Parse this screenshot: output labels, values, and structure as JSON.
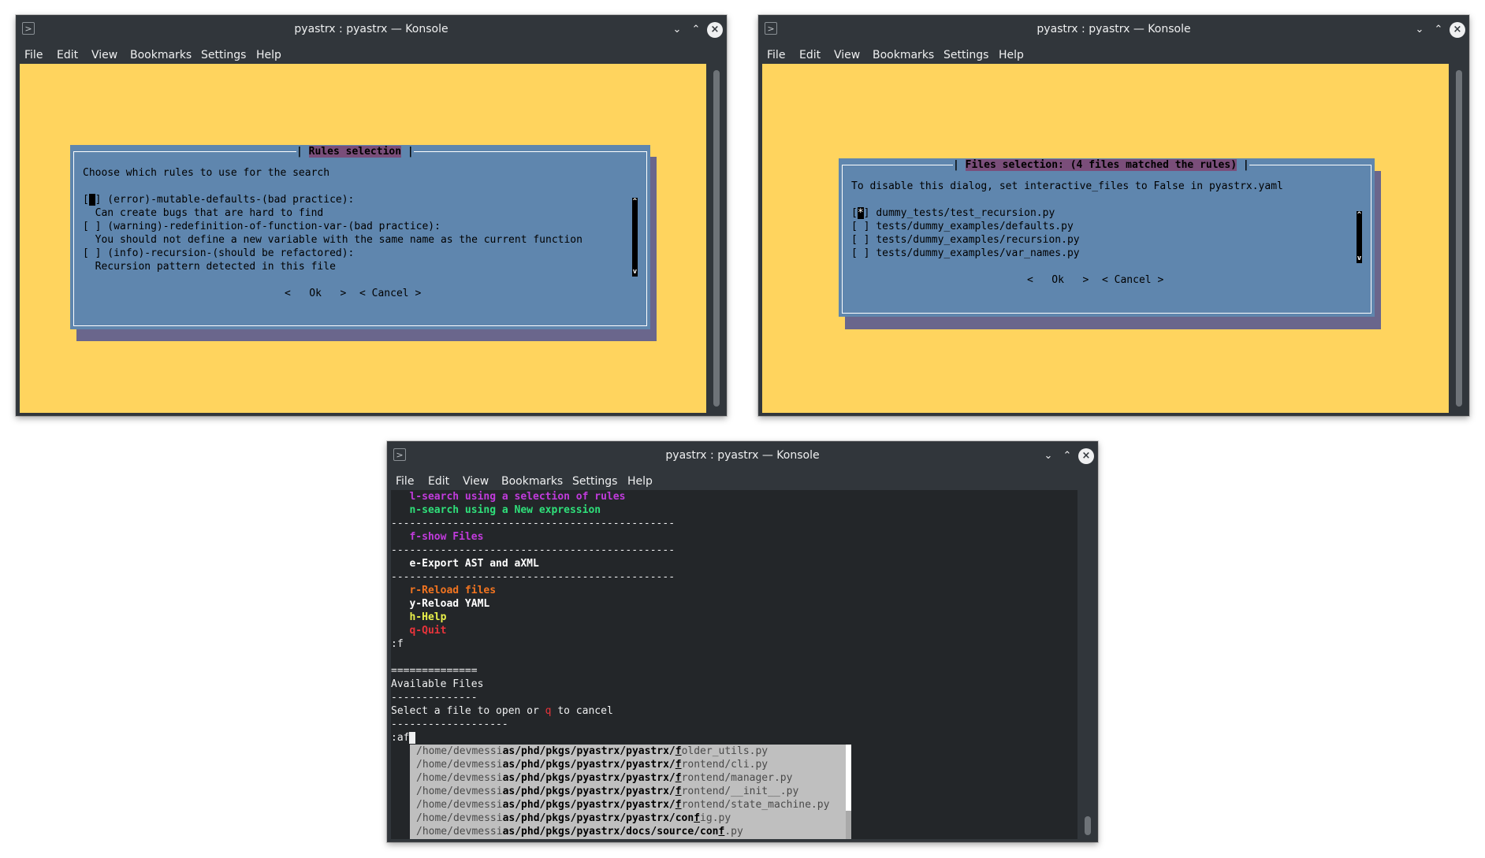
{
  "colors": {
    "konsole_bg": "#31363b",
    "terminal_bg_yellow": "#ffd45e",
    "terminal_bg_dark": "#232629",
    "dialog_blue": "#5f86ae",
    "dialog_shadow": "#6a668c",
    "popup_grey": "#bfbfbf"
  },
  "window_title": "pyastrx : pyastrx — Konsole",
  "menu": [
    "File",
    "Edit",
    "View",
    "Bookmarks",
    "Settings",
    "Help"
  ],
  "rules_dialog": {
    "title": "Rules selection",
    "prompt": "Choose which rules to use for the search",
    "lines": [
      "[ ] (error)-mutable-defaults-(bad practice):",
      "  Can create bugs that are hard to find",
      "[ ] (warning)-redefinition-of-function-var-(bad practice):",
      "  You should not define a new variable with the same name as the current function",
      "[ ] (info)-recursion-(should be refactored):",
      "  Recursion pattern detected in this file"
    ],
    "ok_button": "<   Ok   >",
    "cancel_button": "< Cancel >",
    "scroll_up": "^",
    "scroll_down": "v"
  },
  "files_dialog": {
    "title": "Files selection: (4 files matched the rules)",
    "prompt": "To disable this dialog, set interactive_files to False in pyastrx.yaml",
    "files": [
      "dummy_tests/test_recursion.py",
      "tests/dummy_examples/defaults.py",
      "tests/dummy_examples/recursion.py",
      "tests/dummy_examples/var_names.py"
    ],
    "checkbox": "[ ]",
    "checked_mark": "*",
    "ok_button": "<   Ok   >",
    "cancel_button": "< Cancel >",
    "scroll_up": "^",
    "scroll_down": "v"
  },
  "bottom_terminal": {
    "menu_lines": [
      {
        "text": "   l-search using a selection of rules",
        "color": "magenta"
      },
      {
        "text": "   n-search using a New expression",
        "color": "green"
      },
      {
        "text": "----------------------------------------------",
        "color": "plain"
      },
      {
        "text": "   f-show Files",
        "color": "magenta"
      },
      {
        "text": "----------------------------------------------",
        "color": "plain"
      },
      {
        "text": "   e-Export AST and aXML",
        "color": "white"
      },
      {
        "text": "----------------------------------------------",
        "color": "plain"
      },
      {
        "text": "   r-Reload files",
        "color": "orange"
      },
      {
        "text": "   y-Reload YAML",
        "color": "white"
      },
      {
        "text": "   h-Help",
        "color": "yellow"
      },
      {
        "text": "   q-Quit",
        "color": "red"
      },
      {
        "text": ":f",
        "color": "plain"
      },
      {
        "text": "",
        "color": "plain"
      },
      {
        "text": "==============",
        "color": "plain"
      },
      {
        "text": "Available Files",
        "color": "plain"
      },
      {
        "text": "--------------",
        "color": "plain"
      },
      {
        "text": "Select a file to open or q to cancel",
        "color": "plain"
      },
      {
        "text": "-------------------",
        "color": "plain"
      },
      {
        "text": ":af",
        "color": "plain"
      }
    ],
    "select_prefix": "Select a file to open or ",
    "select_key": "q",
    "select_suffix": " to cancel",
    "completions": [
      {
        "pre": "/home/devmessi",
        "bold": "as/phd/pkgs/pyastrx/pyastrx/",
        "match": "f",
        "post": "older_utils.py"
      },
      {
        "pre": "/home/devmessi",
        "bold": "as/phd/pkgs/pyastrx/pyastrx/",
        "match": "f",
        "post": "rontend/cli.py"
      },
      {
        "pre": "/home/devmessi",
        "bold": "as/phd/pkgs/pyastrx/pyastrx/",
        "match": "f",
        "post": "rontend/manager.py"
      },
      {
        "pre": "/home/devmessi",
        "bold": "as/phd/pkgs/pyastrx/pyastrx/",
        "match": "f",
        "post": "rontend/__init__.py"
      },
      {
        "pre": "/home/devmessi",
        "bold": "as/phd/pkgs/pyastrx/pyastrx/",
        "match": "f",
        "post": "rontend/state_machine.py"
      },
      {
        "pre": "/home/devmessi",
        "bold": "as/phd/pkgs/pyastrx/pyastrx/con",
        "match": "f",
        "post": "ig.py"
      },
      {
        "pre": "/home/devmessi",
        "bold": "as/phd/pkgs/pyastrx/docs/source/con",
        "match": "f",
        "post": ".py"
      }
    ]
  }
}
